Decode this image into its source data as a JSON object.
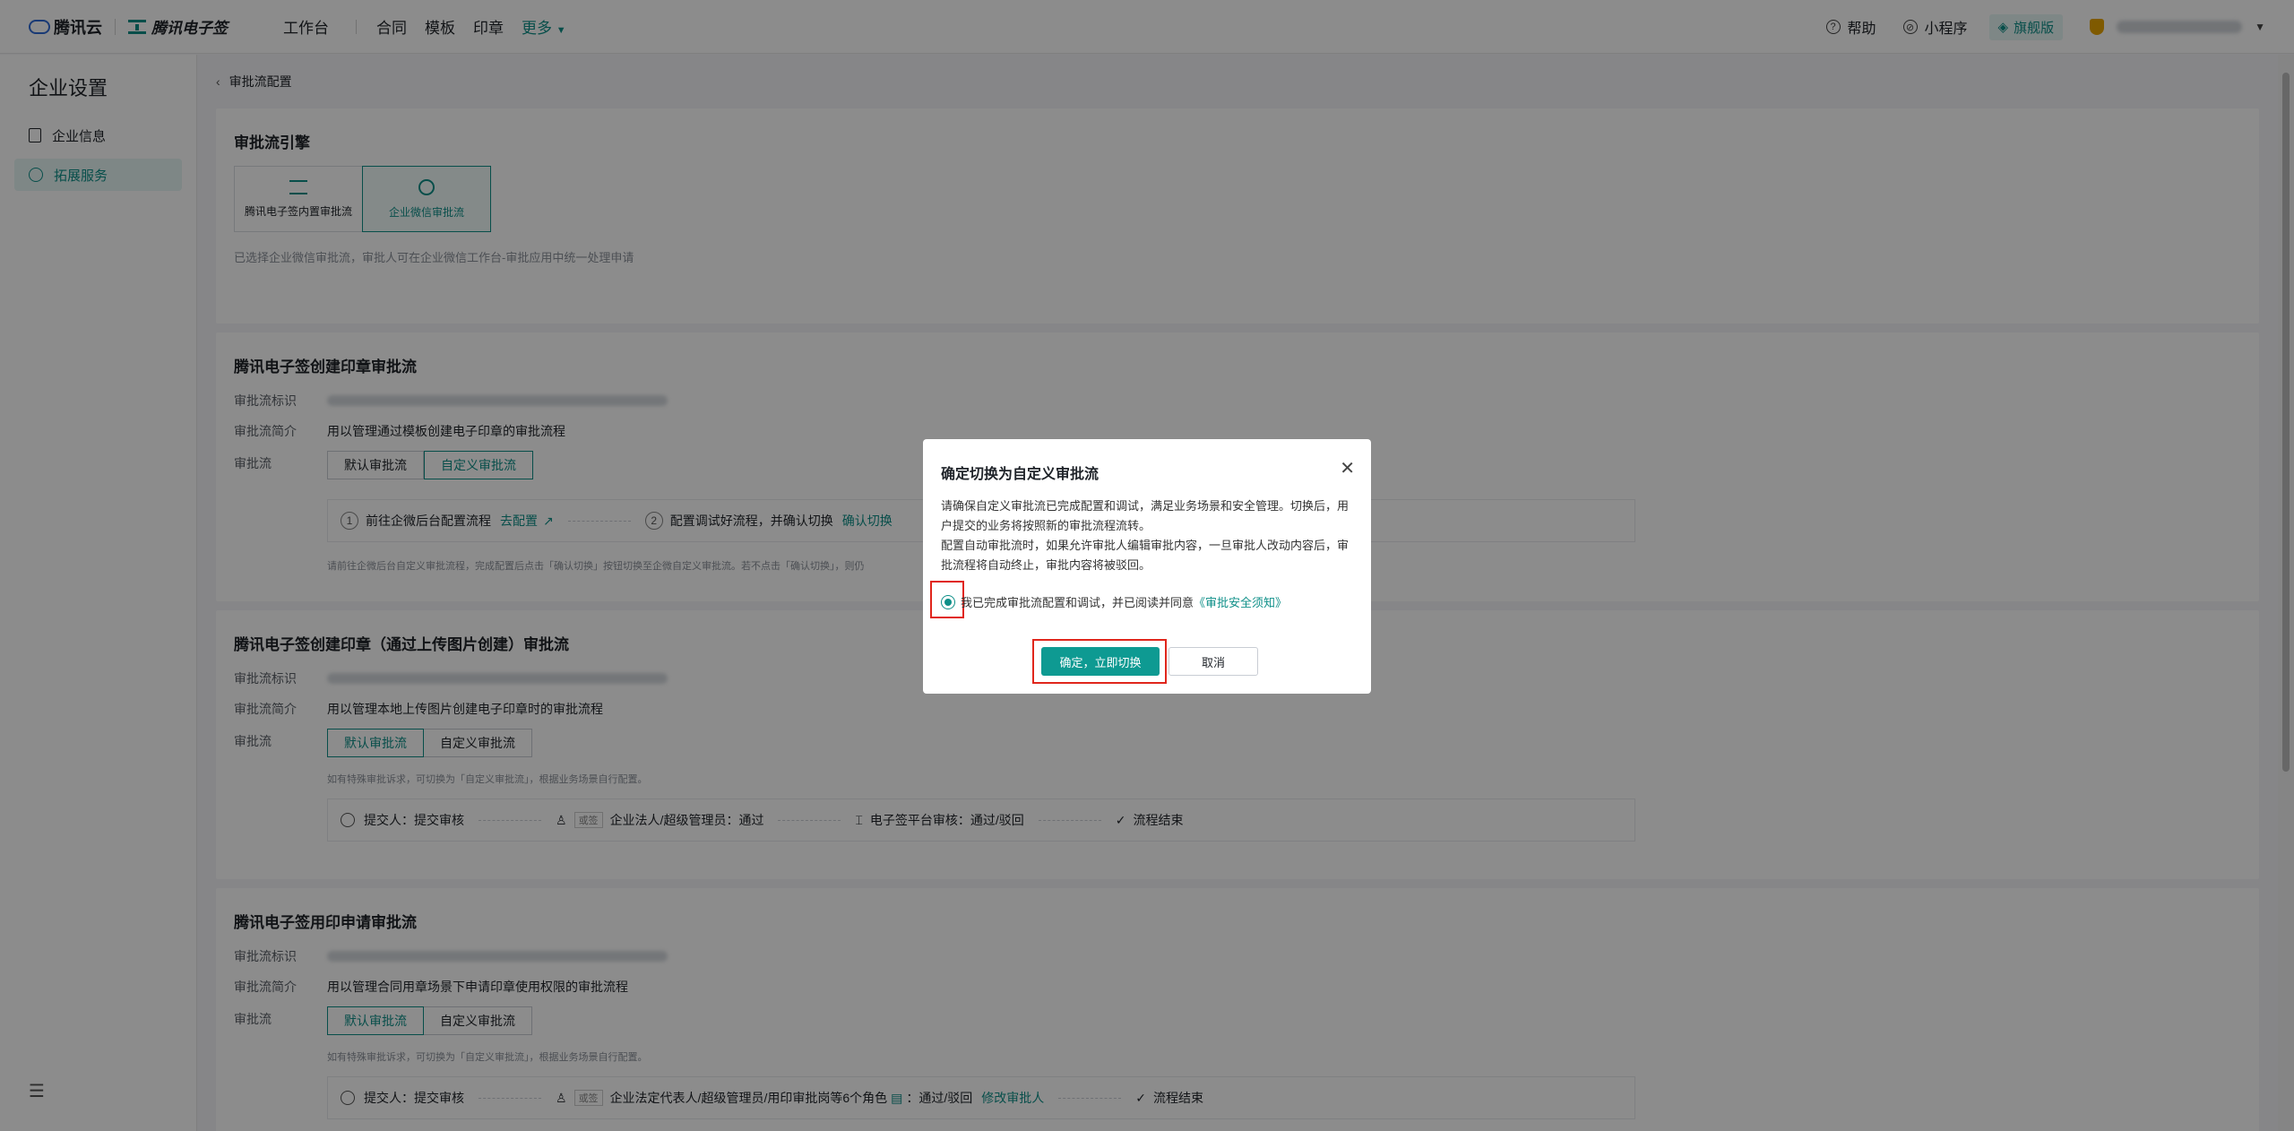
{
  "topbar": {
    "brand": "腾讯云",
    "product": "腾讯电子签",
    "nav": [
      "工作台",
      "合同",
      "模板",
      "印章",
      "更多"
    ],
    "right": {
      "help": "帮助",
      "miniapp": "小程序",
      "edition": "旗舰版"
    }
  },
  "sidebar": {
    "title": "企业设置",
    "items": [
      {
        "label": "企业信息"
      },
      {
        "label": "拓展服务"
      }
    ]
  },
  "breadcrumb": "审批流配置",
  "engine": {
    "title": "审批流引擎",
    "options": [
      "腾讯电子签内置审批流",
      "企业微信审批流"
    ],
    "hint": "已选择企业微信审批流，审批人可在企业微信工作台-审批应用中统一处理申请"
  },
  "sections": [
    {
      "title": "腾讯电子签创建印章审批流",
      "labels": {
        "id": "审批流标识",
        "desc": "审批流简介",
        "flow": "审批流"
      },
      "desc": "用以管理通过模板创建电子印章的审批流程",
      "options": [
        "默认审批流",
        "自定义审批流"
      ],
      "steps": [
        "前往企微后台配置流程",
        "去配置",
        "配置调试好流程，并确认切换",
        "确认切换"
      ],
      "note": "请前往企微后台自定义审批流程，完成配置后点击「确认切换」按钮切换至企微自定义审批流。若不点击「确认切换」，则仍"
    },
    {
      "title": "腾讯电子签创建印章（通过上传图片创建）审批流",
      "desc": "用以管理本地上传图片创建电子印章时的审批流程",
      "note": "如有特殊审批诉求，可切换为「自定义审批流」，根据业务场景自行配置。",
      "flow": [
        "提交人：提交审核",
        "或签",
        "企业法人/超级管理员：通过",
        "电子签平台审核：通过/驳回",
        "流程结束"
      ]
    },
    {
      "title": "腾讯电子签用印申请审批流",
      "desc": "用以管理合同用章场景下申请印章使用权限的审批流程",
      "flow": [
        "提交人：提交审核",
        "或签",
        "企业法定代表人/超级管理员/用印审批岗等6个角色",
        "：通过/驳回",
        "修改审批人",
        "流程结束"
      ]
    }
  ],
  "modal": {
    "title": "确定切换为自定义审批流",
    "body1": "请确保自定义审批流已完成配置和调试，满足业务场景和安全管理。切换后，用户提交的业务将按照新的审批流程流转。",
    "body2": "配置自动审批流时，如果允许审批人编辑审批内容，一旦审批人改动内容后，审批流程将自动终止，审批内容将被驳回。",
    "agree": "我已完成审批流配置和调试，并已阅读并同意",
    "agree_link": "《审批安全须知》",
    "confirm": "确定，立即切换",
    "cancel": "取消"
  }
}
